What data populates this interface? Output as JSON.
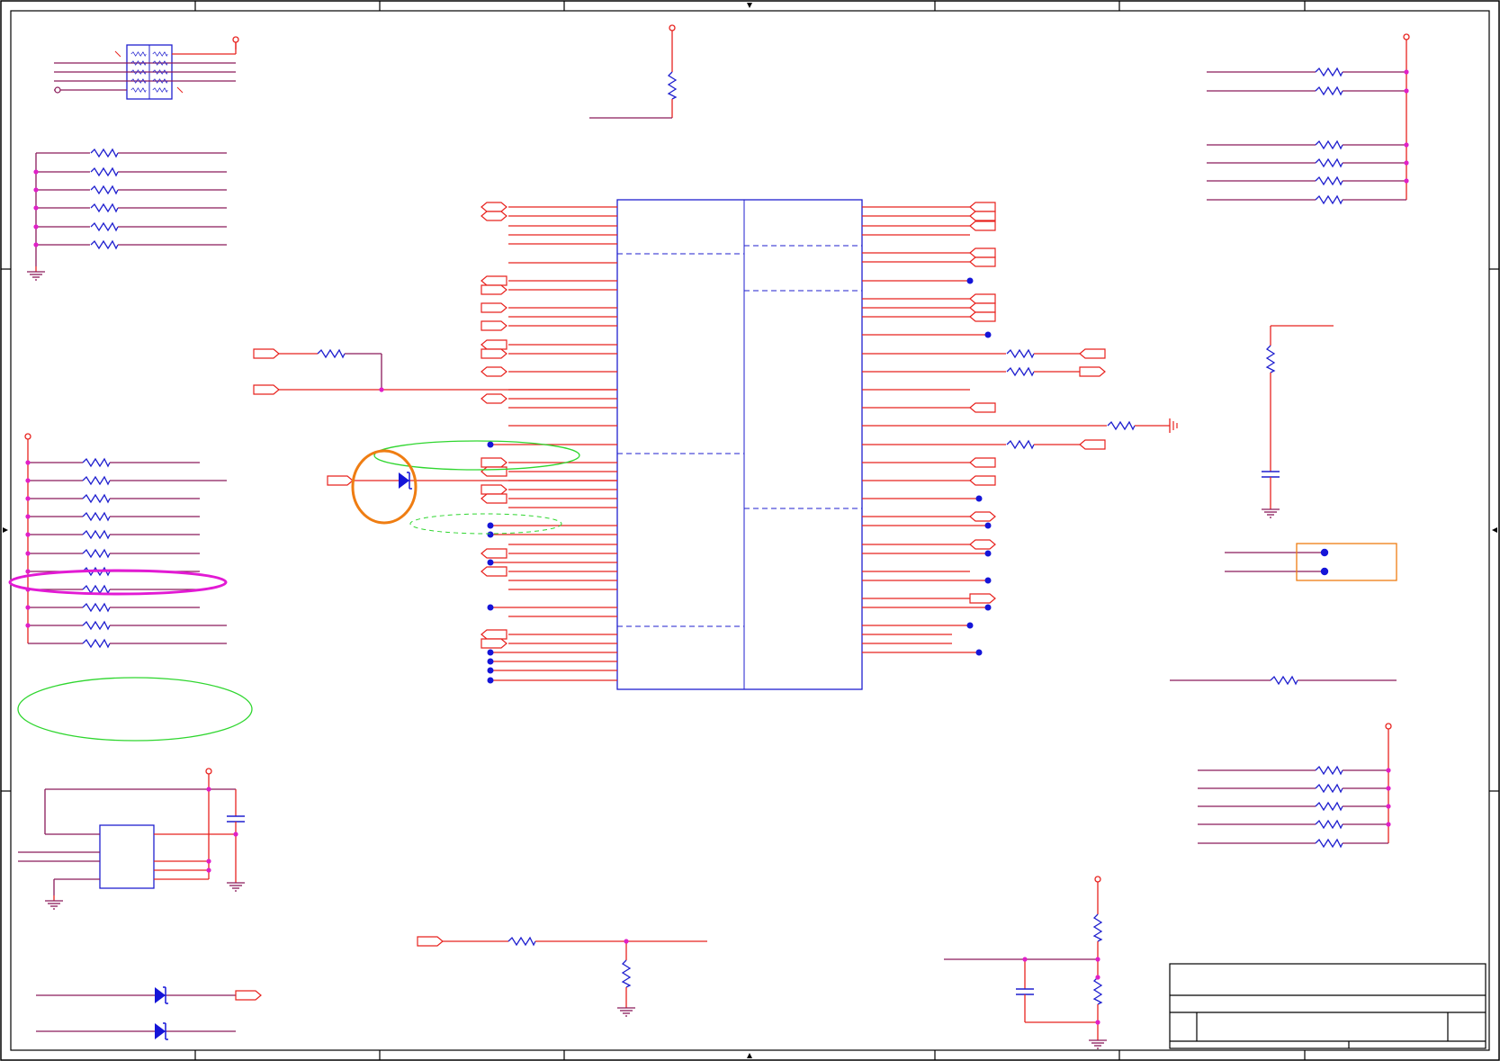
{
  "colors": {
    "wire": "#e8231f",
    "component": "#1f1fcf",
    "net": "#8a1a5a",
    "junction": "#e020c8",
    "dot": "#1515d8",
    "highlight_green": "#2fd62f",
    "highlight_orange": "#ef7d12",
    "highlight_magenta": "#e21ad4",
    "frame": "#000000"
  },
  "components": {
    "main_ic": "ic",
    "resistor_network": "resistor-array",
    "regulator": "regulator-ic",
    "title_block": "title-block"
  }
}
